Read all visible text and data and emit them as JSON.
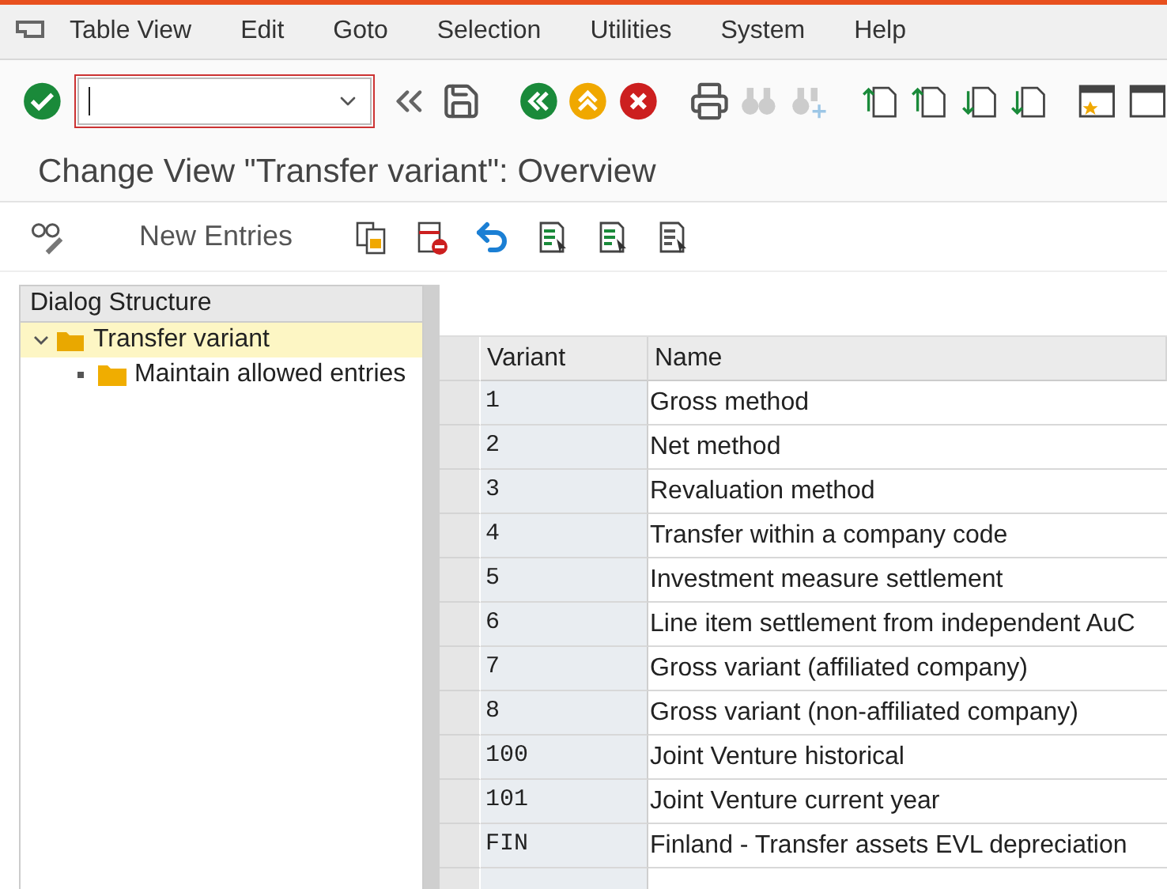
{
  "menu_bar": [
    {
      "label": "Table View"
    },
    {
      "label": "Edit"
    },
    {
      "label": "Goto"
    },
    {
      "label": "Selection"
    },
    {
      "label": "Utilities"
    },
    {
      "label": "System"
    },
    {
      "label": "Help"
    }
  ],
  "page_title": "Change View \"Transfer variant\": Overview",
  "application_toolbar": {
    "new_entries_button": "New Entries"
  },
  "dialog_structure": {
    "title": "Dialog Structure",
    "items": [
      {
        "label": "Transfer variant",
        "selected": true,
        "expanded": true,
        "children": [
          {
            "label": "Maintain allowed entries",
            "selected": false
          }
        ]
      }
    ]
  },
  "table": {
    "columns": [
      "Variant",
      "Name"
    ],
    "rows": [
      {
        "variant": "1",
        "name": "Gross method"
      },
      {
        "variant": "2",
        "name": "Net method"
      },
      {
        "variant": "3",
        "name": "Revaluation method"
      },
      {
        "variant": "4",
        "name": "Transfer within a company code"
      },
      {
        "variant": "5",
        "name": "Investment measure settlement"
      },
      {
        "variant": "6",
        "name": "Line item settlement from independent AuC"
      },
      {
        "variant": "7",
        "name": "Gross variant (affiliated company)"
      },
      {
        "variant": "8",
        "name": "Gross variant (non-affiliated company)"
      },
      {
        "variant": "100",
        "name": "Joint Venture historical"
      },
      {
        "variant": "101",
        "name": "Joint Venture current year"
      },
      {
        "variant": "FIN",
        "name": "Finland - Transfer assets EVL depreciation"
      }
    ]
  }
}
